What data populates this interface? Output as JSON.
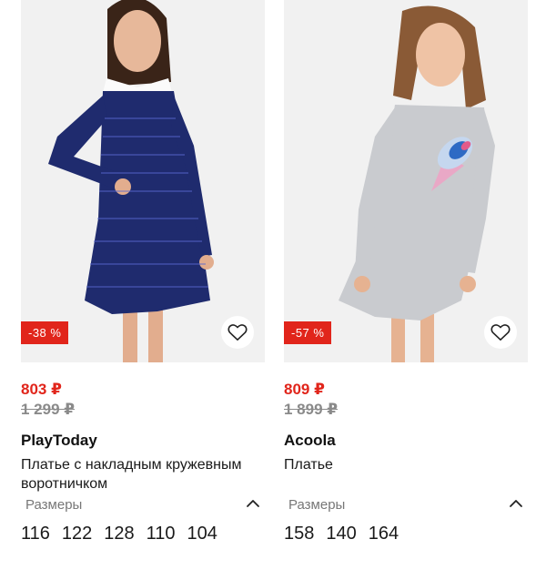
{
  "products": [
    {
      "discount": "-38 %",
      "price": "803 ₽",
      "old_price": "1 299 ₽",
      "brand": "PlayToday",
      "title": "Платье с накладным кружевным воротничком",
      "sizes_label": "Размеры",
      "sizes": [
        "116",
        "122",
        "128",
        "110",
        "104"
      ],
      "colors": {
        "dress": "#1f2b6e",
        "accent": "#e1251b"
      }
    },
    {
      "discount": "-57 %",
      "price": "809 ₽",
      "old_price": "1 899 ₽",
      "brand": "Acoola",
      "title": "Платье",
      "sizes_label": "Размеры",
      "sizes": [
        "158",
        "140",
        "164"
      ],
      "colors": {
        "dress": "#c9cbcf",
        "accent": "#e1251b"
      }
    }
  ]
}
